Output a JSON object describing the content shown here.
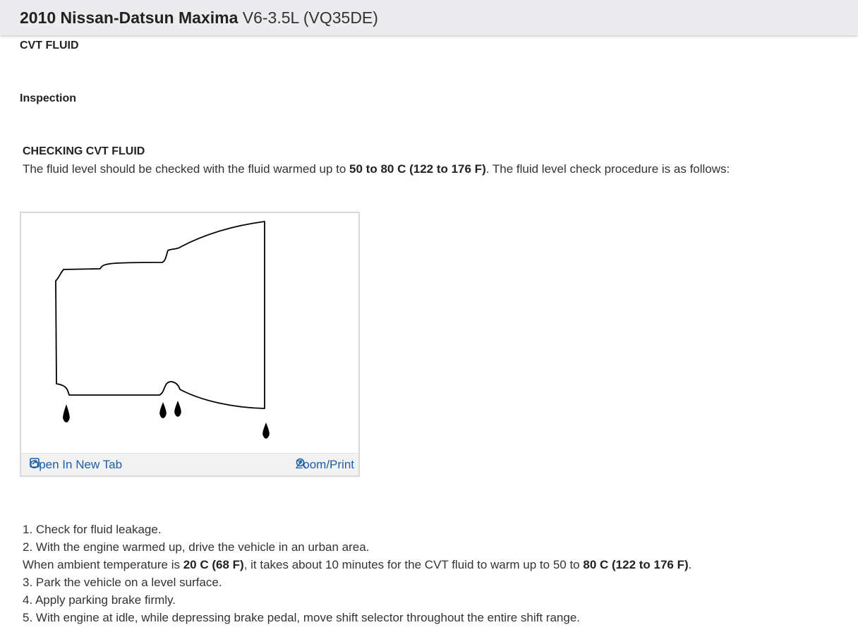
{
  "header": {
    "vehicle": "2010 Nissan-Datsun Maxima",
    "engine": "V6-3.5L (VQ35DE)"
  },
  "section_title": "CVT FLUID",
  "subsection_title": "Inspection",
  "checking": {
    "title": "CHECKING CVT FLUID",
    "intro_pre": "The fluid level should be checked with the fluid warmed up to ",
    "intro_bold": "50 to 80 C (122 to 176 F)",
    "intro_post": ". The fluid level check procedure is as follows:"
  },
  "figure": {
    "open_tab_label": "Open In New Tab",
    "zoom_label": "Zoom/Print",
    "icons": [
      "open-new-tab-icon",
      "zoom-in-icon"
    ]
  },
  "steps": {
    "s1": "1. Check for fluid leakage.",
    "s2": "2. With the engine warmed up, drive the vehicle in an urban area.",
    "note_a": "When ambient temperature is ",
    "note_b": "20 C (68 F)",
    "note_c": ", it takes about 10 minutes for the CVT fluid to warm up to 50 to ",
    "note_d": "80 C (122 to 176 F)",
    "note_e": ".",
    "s3": "3. Park the vehicle on a level surface.",
    "s4": "4. Apply parking brake firmly.",
    "s5": "5. With engine at idle, while depressing brake pedal, move shift selector throughout the entire shift range."
  },
  "colors": {
    "link": "#1a5fa8",
    "header_bg": "#ececee"
  }
}
